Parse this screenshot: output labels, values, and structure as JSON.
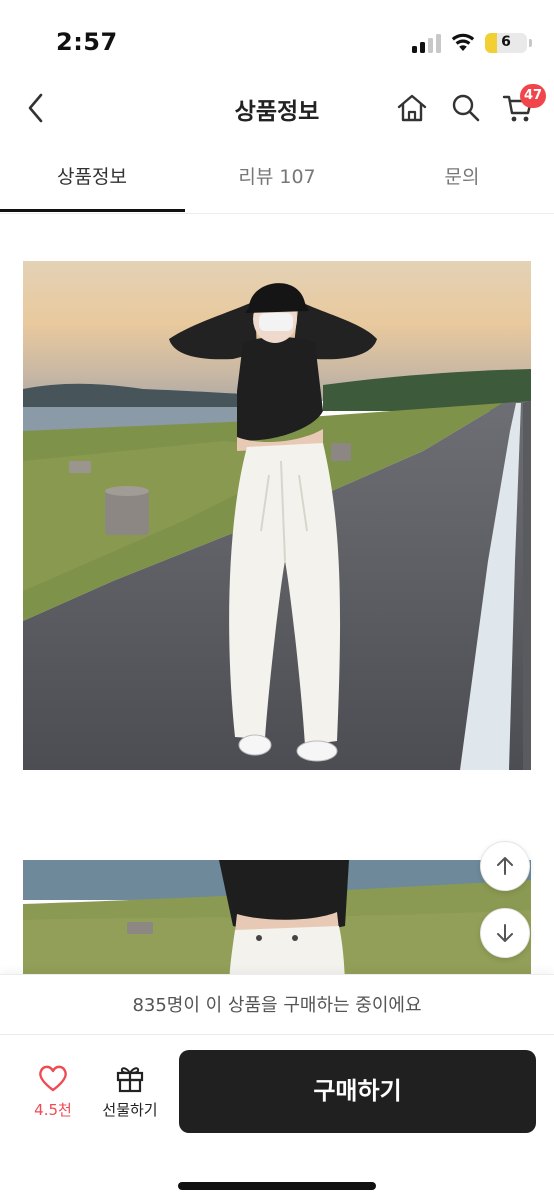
{
  "status_bar": {
    "time": "2:57",
    "battery": "6"
  },
  "nav": {
    "title": "상품정보",
    "cart_badge": "47"
  },
  "tabs": [
    {
      "label": "상품정보",
      "active": true
    },
    {
      "label": "리뷰 107",
      "active": false
    },
    {
      "label": "문의",
      "active": false
    }
  ],
  "banner": {
    "text": "835명이 이 상품을 구매하는 중이에요"
  },
  "bottom_bar": {
    "like_count": "4.5천",
    "gift_label": "선물하기",
    "buy_label": "구매하기"
  },
  "colors": {
    "accent": "#f0454b",
    "buy_button": "#202020",
    "like": "#ef4b55"
  },
  "icons": [
    "back-arrow-icon",
    "home-icon",
    "search-icon",
    "cart-icon",
    "heart-icon",
    "gift-icon",
    "arrow-up-icon",
    "arrow-down-icon"
  ]
}
